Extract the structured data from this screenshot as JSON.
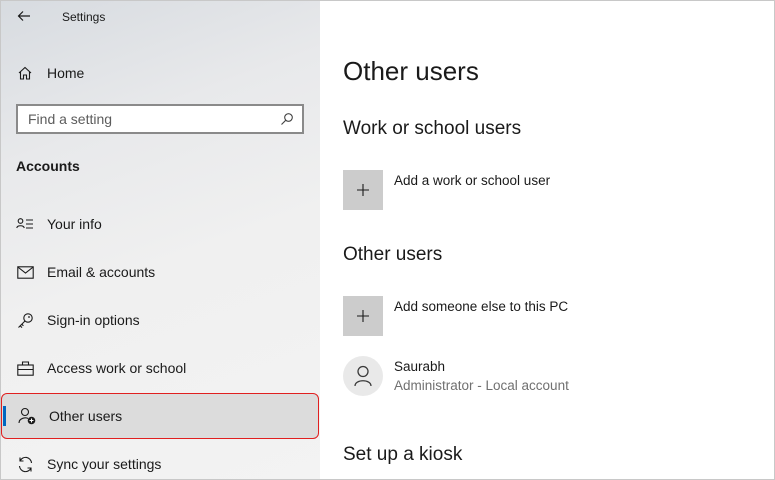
{
  "window": {
    "title": "Settings"
  },
  "sidebar": {
    "home_label": "Home",
    "search": {
      "placeholder": "Find a setting"
    },
    "section": "Accounts",
    "items": [
      {
        "label": "Your info",
        "icon": "person-card-icon"
      },
      {
        "label": "Email & accounts",
        "icon": "mail-icon"
      },
      {
        "label": "Sign-in options",
        "icon": "key-icon"
      },
      {
        "label": "Access work or school",
        "icon": "briefcase-icon"
      },
      {
        "label": "Other users",
        "icon": "person-add-icon",
        "selected": true
      },
      {
        "label": "Sync your settings",
        "icon": "sync-icon"
      }
    ]
  },
  "main": {
    "title": "Other users",
    "work_section": {
      "heading": "Work or school users",
      "add_label": "Add a work or school user"
    },
    "other_section": {
      "heading": "Other users",
      "add_label": "Add someone else to this PC"
    },
    "user": {
      "name": "Saurabh",
      "description": "Administrator - Local account"
    },
    "kiosk_heading": "Set up a kiosk"
  },
  "colors": {
    "accent": "#0067c0",
    "highlight_outline": "#e02020",
    "tile": "#cccccc"
  }
}
